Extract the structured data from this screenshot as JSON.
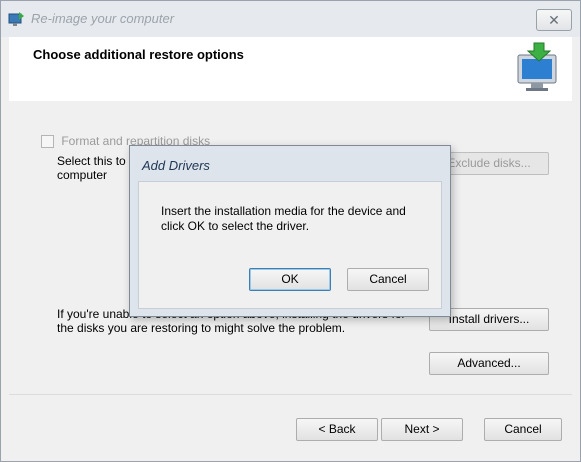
{
  "window": {
    "title": "Re-image your computer",
    "close_symbol": "✕"
  },
  "header": {
    "title": "Choose additional restore options",
    "icon": "monitor-restore-icon"
  },
  "content": {
    "format_checkbox": {
      "label": "Format and repartition disks",
      "checked": false,
      "enabled": false
    },
    "format_description": "Select this to delete existing partitions and reformat all disks on this computer",
    "exclude_disks_label": "Exclude disks...",
    "drivers_description": "If you're unable to select an option above, installing the drivers for the disks you are restoring to might solve the problem.",
    "install_drivers_label": "Install drivers...",
    "advanced_label": "Advanced..."
  },
  "footer": {
    "back_label": "< Back",
    "next_label": "Next >",
    "cancel_label": "Cancel"
  },
  "dialog": {
    "title": "Add Drivers",
    "message": "Insert the installation media for the device and click OK to select the driver.",
    "ok_label": "OK",
    "cancel_label": "Cancel"
  }
}
